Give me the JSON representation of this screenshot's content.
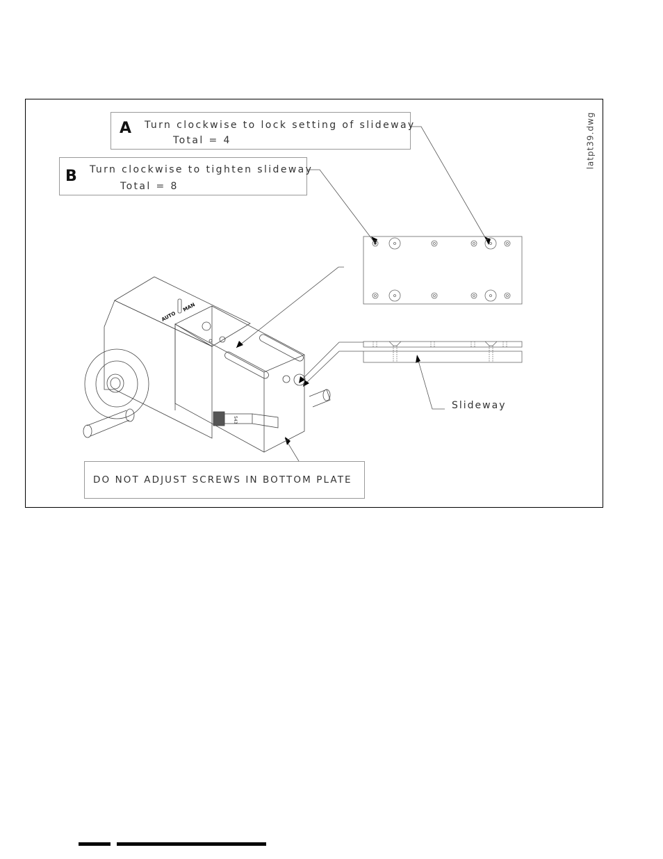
{
  "figure": {
    "drawing_id": "latpt39.dwg",
    "callouts": [
      {
        "letter": "A",
        "instruction": "Turn clockwise to lock setting of slideway",
        "total": "Total = 4"
      },
      {
        "letter": "B",
        "instruction": "Turn clockwise to tighten slideway",
        "total": "Total = 8"
      }
    ],
    "warning": "DO NOT ADJUST SCREWS IN BOTTOM PLATE",
    "part_label": "Slideway",
    "switch_labels": {
      "auto": "AUTO",
      "man": "MAN"
    },
    "micrometer_scale": "543"
  }
}
